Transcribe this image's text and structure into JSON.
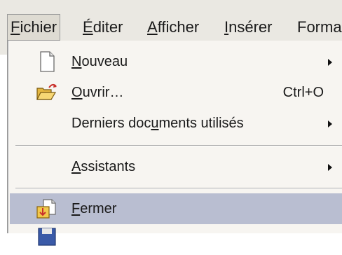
{
  "menubar": {
    "items": [
      {
        "first": "F",
        "rest": "ichier"
      },
      {
        "first": "É",
        "rest": "diter"
      },
      {
        "first": "A",
        "rest": "fficher"
      },
      {
        "first": "I",
        "rest": "nsérer"
      },
      {
        "first": "",
        "rest": "Forma"
      }
    ]
  },
  "menu": {
    "items": [
      {
        "icon": "new-document-icon",
        "first": "N",
        "rest": "ouveau",
        "submenu": true
      },
      {
        "icon": "open-folder-icon",
        "first": "O",
        "rest": "uvrir…",
        "shortcut": "Ctrl+O"
      },
      {
        "pre": "Derniers doc",
        "ul": "u",
        "post": "ments utilisés",
        "submenu": true
      },
      {
        "first": "A",
        "rest": "ssistants",
        "submenu": true
      },
      {
        "icon": "close-document-icon",
        "first": "F",
        "rest": "ermer",
        "highlighted": true
      }
    ]
  },
  "colors": {
    "menubar_bg": "#eae8e2",
    "menu_bg": "#f7f5f1",
    "highlight": "#b9bed1"
  }
}
